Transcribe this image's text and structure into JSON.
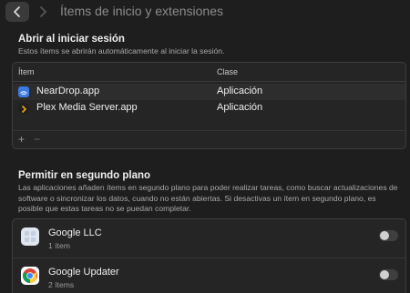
{
  "toolbar": {
    "back_icon": "chevron-left-icon",
    "forward_icon": "chevron-right-icon",
    "title": "Ítems de inicio y extensiones"
  },
  "login": {
    "title": "Abrir al iniciar sesión",
    "subtitle": "Estos ítems se abrirán automáticamente al iniciar la sesión.",
    "columns": {
      "item": "Ítem",
      "kind": "Clase"
    },
    "items": [
      {
        "name": "NearDrop.app",
        "kind": "Aplicación",
        "icon": "neardrop-app-icon"
      },
      {
        "name": "Plex Media Server.app",
        "kind": "Aplicación",
        "icon": "plex-app-icon"
      }
    ],
    "add_label": "+",
    "remove_label": "−"
  },
  "background": {
    "title": "Permitir en segundo plano",
    "description": "Las aplicaciones añaden ítems en segundo plano para poder realizar tareas, como buscar actualizaciones de software o sincronizar los datos, cuando no están abiertas. Si desactivas un ítem en segundo plano, es posible que estas tareas no se puedan completar.",
    "items": [
      {
        "name": "Google LLC",
        "count": "1 ítem",
        "enabled": false,
        "icon": "google-llc-icon"
      },
      {
        "name": "Google Updater",
        "count": "2 ítems",
        "enabled": false,
        "icon": "chrome-icon"
      }
    ]
  },
  "colors": {
    "background": "#1e1e1e",
    "panel": "#252525",
    "text": "#efefef",
    "muted": "#a8a8a8"
  }
}
